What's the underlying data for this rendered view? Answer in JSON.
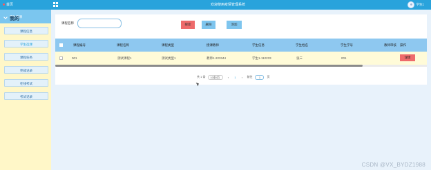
{
  "app": {
    "system_title": "欢迎使用疫情管理系统",
    "home_label": "首页",
    "user_name": "学生1"
  },
  "sidebar": {
    "current_section": "我的",
    "header_label": "学生选课",
    "items": [
      {
        "label": "课程信息"
      },
      {
        "label": "学生选课",
        "active": true
      },
      {
        "label": "课程任务"
      },
      {
        "label": "完成记录"
      },
      {
        "label": "在线考试"
      },
      {
        "label": "考试记录"
      }
    ]
  },
  "search": {
    "label": "课程名称",
    "value": "",
    "buttons": {
      "search": "搜索",
      "delete": "删除",
      "add": "添加"
    }
  },
  "table": {
    "columns": [
      "课程编号",
      "课程名称",
      "课程类型",
      "授课教师",
      "学生信息",
      "学生姓名",
      "学生学号",
      "教师审核",
      "操作"
    ],
    "rows": [
      {
        "课程编号": "001",
        "课程名称": "测试课程1",
        "课程类型": "测试类型1",
        "授课教师": "教师1-223344",
        "学生信息": "学生1-112233",
        "学生姓名": "张三",
        "学生学号": "001",
        "教师审核": "",
        "action": "详情"
      }
    ]
  },
  "pagination": {
    "total_text": "共 1 条",
    "page_size": "10条/页",
    "prev": "‹",
    "current_page": "1",
    "next": "›",
    "goto_prefix": "前往",
    "goto_value": "1",
    "goto_suffix": "页"
  },
  "watermark": "CSDN @VX_BYDZ1988",
  "colors": {
    "topbar": "#29a3dc",
    "sidebar_bg": "#fff7c8",
    "table_header": "#8ec8f0",
    "row_bg": "#fffbd8",
    "danger_button": "#ee6b6b",
    "primary_button": "#7ec5ee"
  }
}
